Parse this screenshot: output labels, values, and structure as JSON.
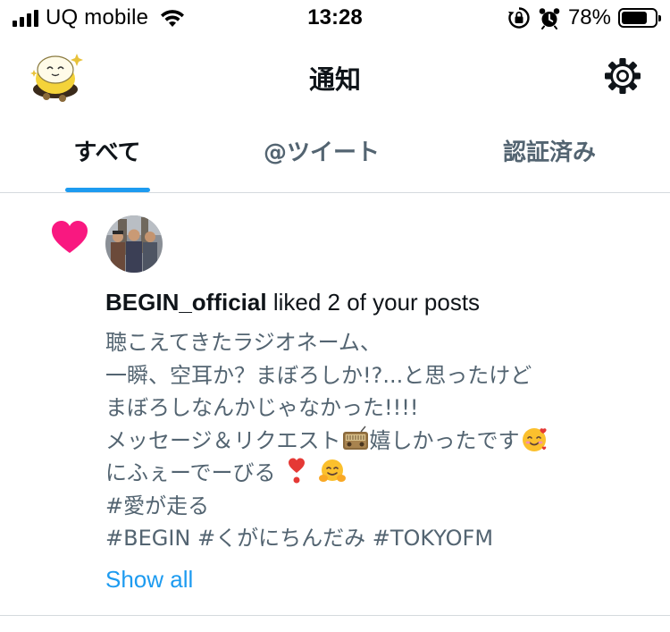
{
  "status_bar": {
    "carrier": "UQ mobile",
    "time": "13:28",
    "battery_percent": "78%",
    "battery_level": 0.78,
    "icons": [
      "signal-icon",
      "wifi-icon",
      "orientation-lock-icon",
      "alarm-icon",
      "battery-icon"
    ]
  },
  "header": {
    "title": "通知",
    "avatar_icon": "profile-avatar",
    "settings_icon": "gear-icon"
  },
  "tabs": [
    {
      "label": "すべて",
      "active": true
    },
    {
      "label": "@ツイート",
      "active": false
    },
    {
      "label": "認証済み",
      "active": false
    }
  ],
  "notification": {
    "type_icon": "heart-icon",
    "username": "BEGIN_official",
    "action_text": " liked 2 of your posts",
    "post_lines": [
      "聴こえてきたラジオネーム、",
      "一瞬、空耳か？まぼろしか!?...と思ったけど",
      "まぼろしなんかじゃなかった!!!!",
      "メッセージ＆リクエスト",
      "嬉しかったです",
      "にふぇーでーびる",
      "#愛が走る",
      "#BEGIN #くがにちんだみ #TOKYOFM"
    ],
    "emoji_icons": [
      "radio-emoji-icon",
      "smiling-hearts-emoji-icon",
      "heart-exclamation-emoji-icon",
      "hugging-face-emoji-icon"
    ],
    "show_all": "Show all"
  },
  "colors": {
    "accent": "#1d9bf0",
    "heart": "#f91880",
    "text_primary": "#0f1419",
    "text_secondary": "#536471",
    "divider": "#d5dade"
  }
}
